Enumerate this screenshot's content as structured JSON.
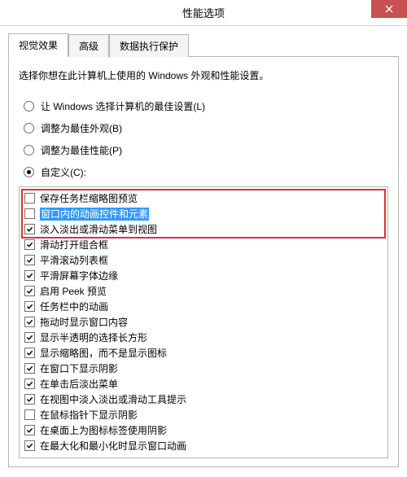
{
  "window": {
    "title": "性能选项",
    "close_tooltip": "关闭"
  },
  "tabs": [
    {
      "label": "视觉效果",
      "active": true
    },
    {
      "label": "高级",
      "active": false
    },
    {
      "label": "数据执行保护",
      "active": false
    }
  ],
  "description": "选择你想在此计算机上使用的 Windows 外观和性能设置。",
  "radios": [
    {
      "label": "让 Windows 选择计算机的最佳设置(L)",
      "checked": false
    },
    {
      "label": "调整为最佳外观(B)",
      "checked": false
    },
    {
      "label": "调整为最佳性能(P)",
      "checked": false
    },
    {
      "label": "自定义(C):",
      "checked": true
    }
  ],
  "highlight_rows": [
    0,
    1,
    2
  ],
  "selected_row": 1,
  "checks": [
    {
      "label": "保存任务栏缩略图预览",
      "checked": false
    },
    {
      "label": "窗口内的动画控件和元素",
      "checked": false
    },
    {
      "label": "淡入淡出或滑动菜单到视图",
      "checked": true
    },
    {
      "label": "滑动打开组合框",
      "checked": true
    },
    {
      "label": "平滑滚动列表框",
      "checked": true
    },
    {
      "label": "平滑屏幕字体边缘",
      "checked": true
    },
    {
      "label": "启用 Peek 预览",
      "checked": true
    },
    {
      "label": "任务栏中的动画",
      "checked": true
    },
    {
      "label": "拖动时显示窗口内容",
      "checked": true
    },
    {
      "label": "显示半透明的选择长方形",
      "checked": true
    },
    {
      "label": "显示缩略图，而不是显示图标",
      "checked": true
    },
    {
      "label": "在窗口下显示阴影",
      "checked": true
    },
    {
      "label": "在单击后淡出菜单",
      "checked": true
    },
    {
      "label": "在视图中淡入淡出或滑动工具提示",
      "checked": true
    },
    {
      "label": "在鼠标指针下显示阴影",
      "checked": false
    },
    {
      "label": "在桌面上为图标标签使用阴影",
      "checked": true
    },
    {
      "label": "在最大化和最小化时显示窗口动画",
      "checked": true
    }
  ]
}
